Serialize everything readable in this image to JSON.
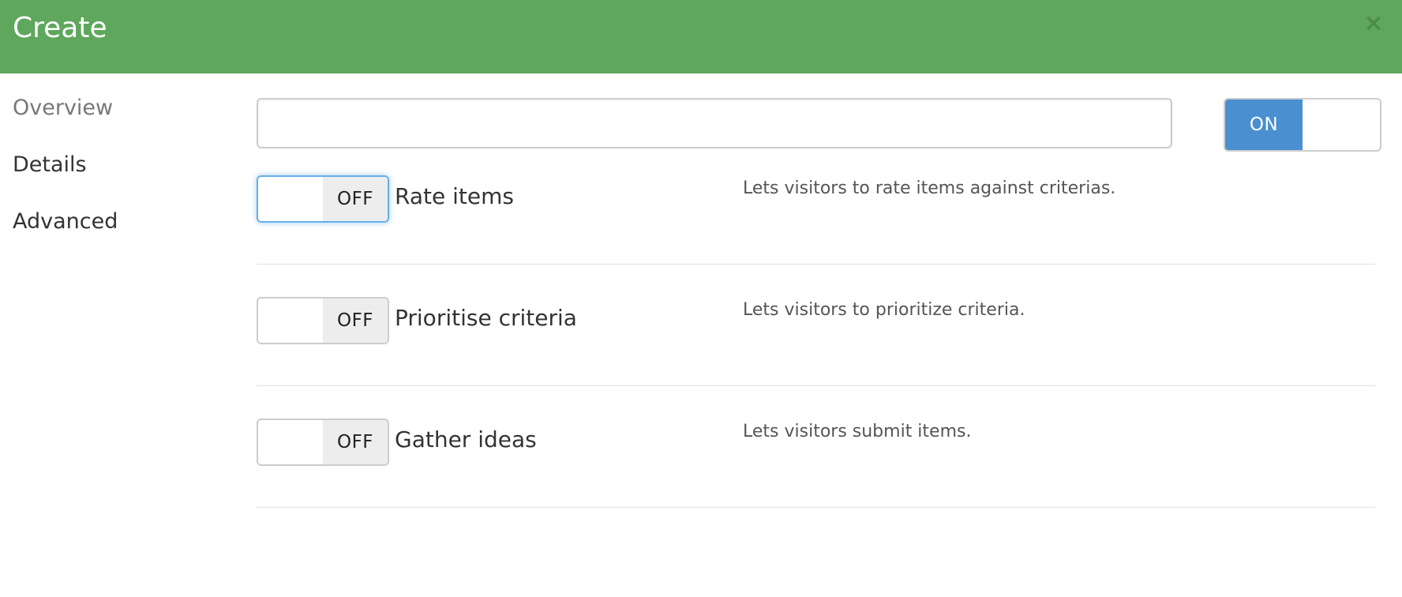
{
  "header": {
    "title": "Create",
    "close_label": "×"
  },
  "sidebar": {
    "items": [
      {
        "label": "Overview"
      },
      {
        "label": "Details"
      },
      {
        "label": "Advanced"
      }
    ]
  },
  "main": {
    "title_input": {
      "value": "",
      "placeholder": ""
    },
    "top_switch": {
      "state_label": "ON"
    },
    "options": [
      {
        "switch_label": "OFF",
        "label": "Rate items",
        "description": "Lets visitors to rate items against criterias."
      },
      {
        "switch_label": "OFF",
        "label": "Prioritise criteria",
        "description": "Lets visitors to prioritize criteria."
      },
      {
        "switch_label": "OFF",
        "label": "Gather ideas",
        "description": "Lets visitors submit items."
      }
    ]
  },
  "colors": {
    "header_bg": "#5ea75c",
    "switch_on_bg": "#4a8fd0",
    "switch_off_bg": "#ededed",
    "focus_ring": "#66afe9"
  },
  "icons": {
    "close": "close-icon"
  }
}
